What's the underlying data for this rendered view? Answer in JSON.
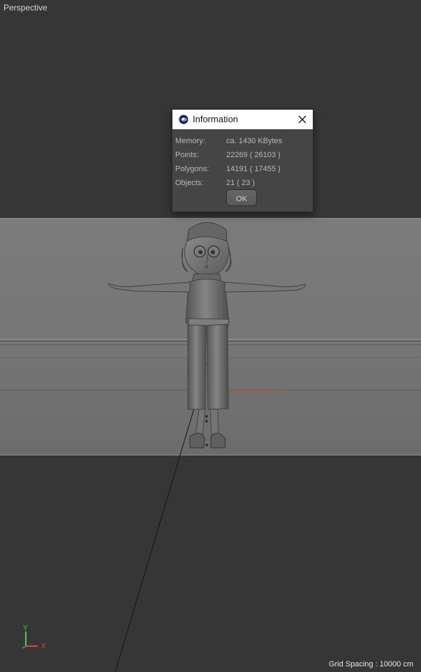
{
  "viewport": {
    "label": "Perspective"
  },
  "dialog": {
    "title": "Information",
    "icon": "cinema4d-logo-icon",
    "rows": [
      {
        "label": "Memory:",
        "value": "ca. 1430 KBytes"
      },
      {
        "label": "Points:",
        "value": "22269 ( 26103 )"
      },
      {
        "label": "Polygons:",
        "value": "14191 ( 17455 )"
      },
      {
        "label": "Objects:",
        "value": "21 ( 23 )"
      }
    ],
    "ok_label": "OK"
  },
  "axis": {
    "y": "Y",
    "x": "X",
    "colors": {
      "x": "#d34b39",
      "y": "#55c94c",
      "z": "#456bd8"
    }
  },
  "status": {
    "grid_spacing": "Grid Spacing : 10000 cm"
  }
}
